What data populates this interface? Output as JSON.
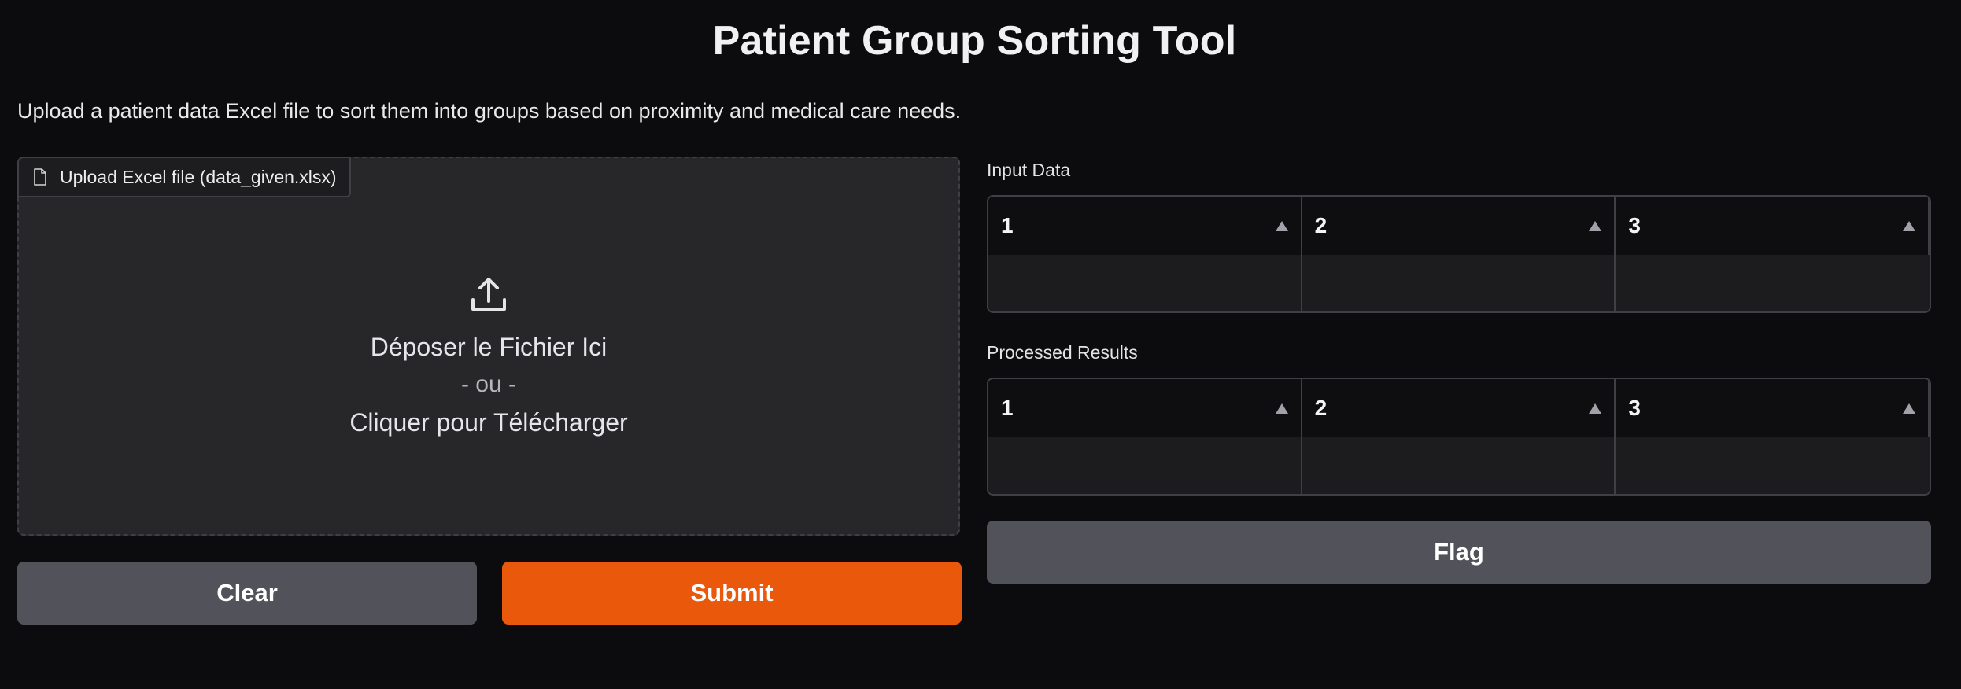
{
  "header": {
    "title": "Patient Group Sorting Tool",
    "description": "Upload a patient data Excel file to sort them into groups based on proximity and medical care needs."
  },
  "upload": {
    "label": "Upload Excel file (data_given.xlsx)",
    "label_icon": "file-icon",
    "drop_icon": "upload-icon",
    "drop_text": "Déposer le Fichier Ici",
    "or_text": "- ou -",
    "click_text": "Cliquer pour Télécharger"
  },
  "buttons": {
    "clear": "Clear",
    "submit": "Submit",
    "flag": "Flag"
  },
  "input_table": {
    "label": "Input Data",
    "columns": [
      "1",
      "2",
      "3"
    ]
  },
  "results_table": {
    "label": "Processed Results",
    "columns": [
      "1",
      "2",
      "3"
    ]
  },
  "colors": {
    "background": "#0c0c0e",
    "primary": "#ea580c",
    "secondary": "#52525b"
  }
}
